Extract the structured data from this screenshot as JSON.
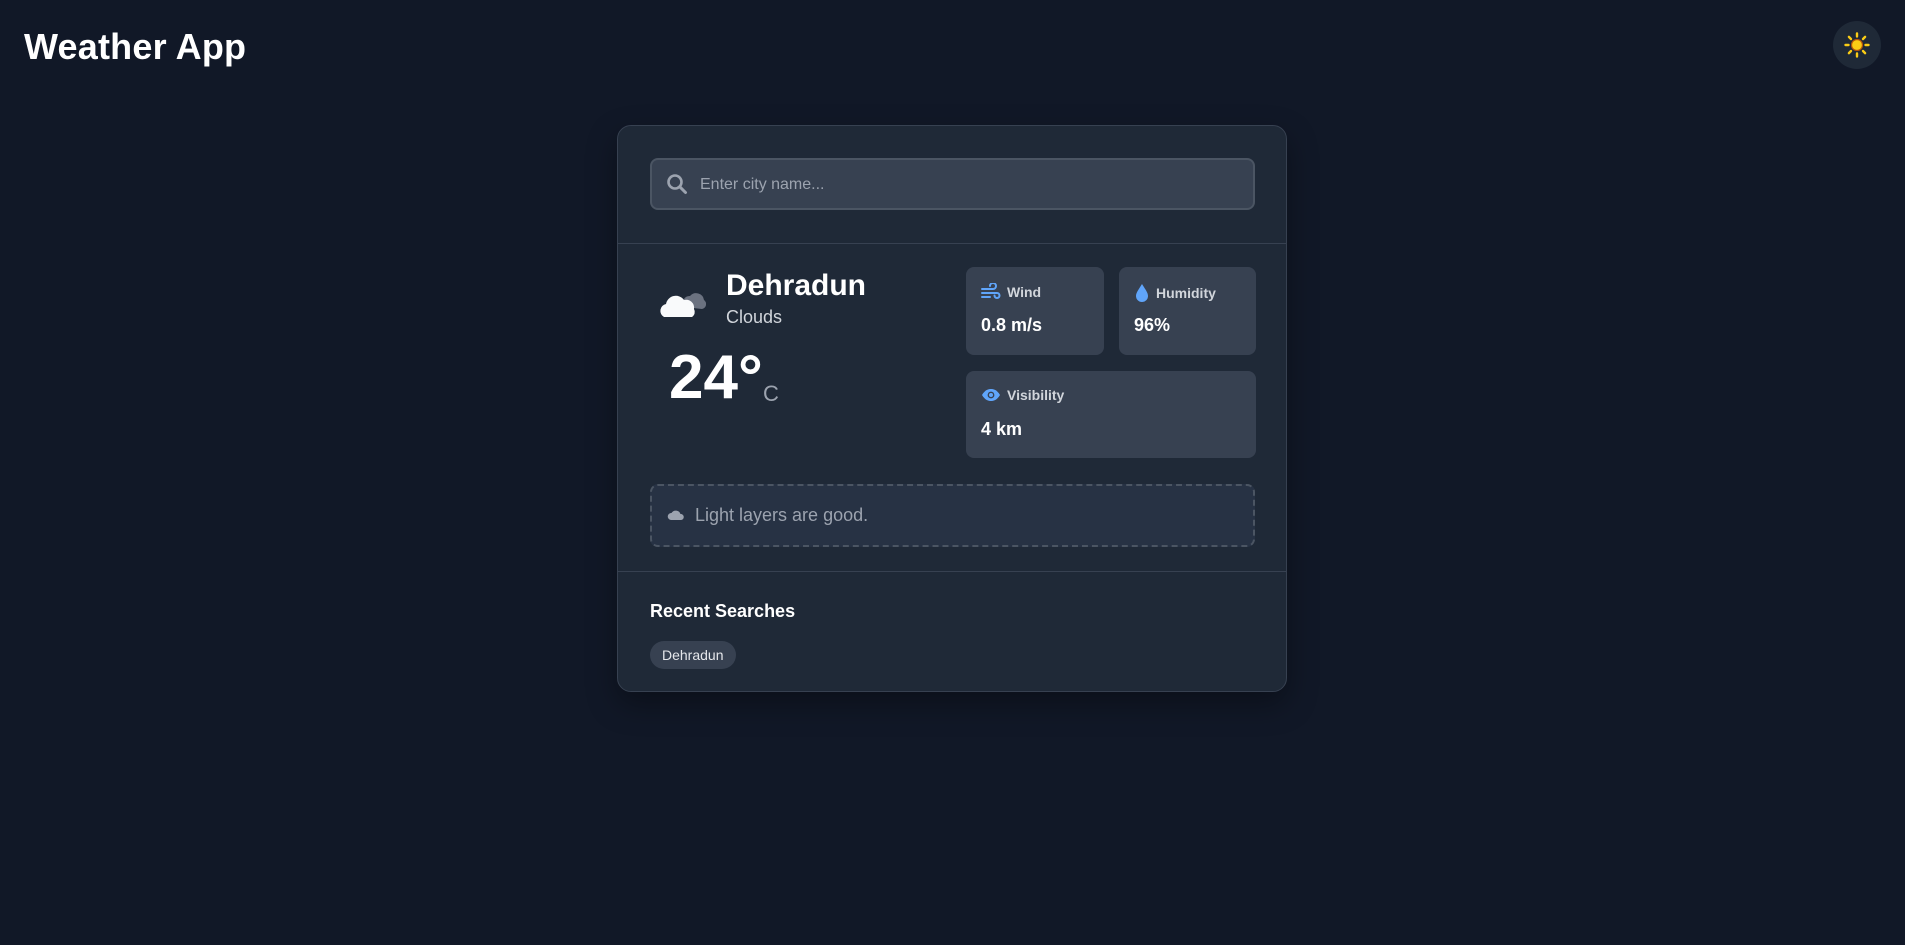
{
  "app": {
    "title": "Weather App",
    "theme_toggle_icon": "sun-icon"
  },
  "search": {
    "placeholder": "Enter city name...",
    "value": "",
    "icon": "search-icon"
  },
  "current": {
    "city": "Dehradun",
    "condition": "Clouds",
    "condition_icon": "clouds-icon",
    "temperature": "24°",
    "unit": "C"
  },
  "stats": {
    "wind": {
      "label": "Wind",
      "value": "0.8 m/s",
      "icon": "wind-icon"
    },
    "humidity": {
      "label": "Humidity",
      "value": "96%",
      "icon": "droplet-icon"
    },
    "visibility": {
      "label": "Visibility",
      "value": "4 km",
      "icon": "eye-icon"
    }
  },
  "tip": {
    "text": "Light layers are good.",
    "icon": "cloud-icon"
  },
  "recent": {
    "heading": "Recent Searches",
    "items": [
      "Dehradun"
    ]
  },
  "colors": {
    "background": "#111827",
    "card": "#1f2937",
    "stat_card": "#374151",
    "accent_blue": "#60a5fa",
    "sun_yellow": "#facc15"
  }
}
